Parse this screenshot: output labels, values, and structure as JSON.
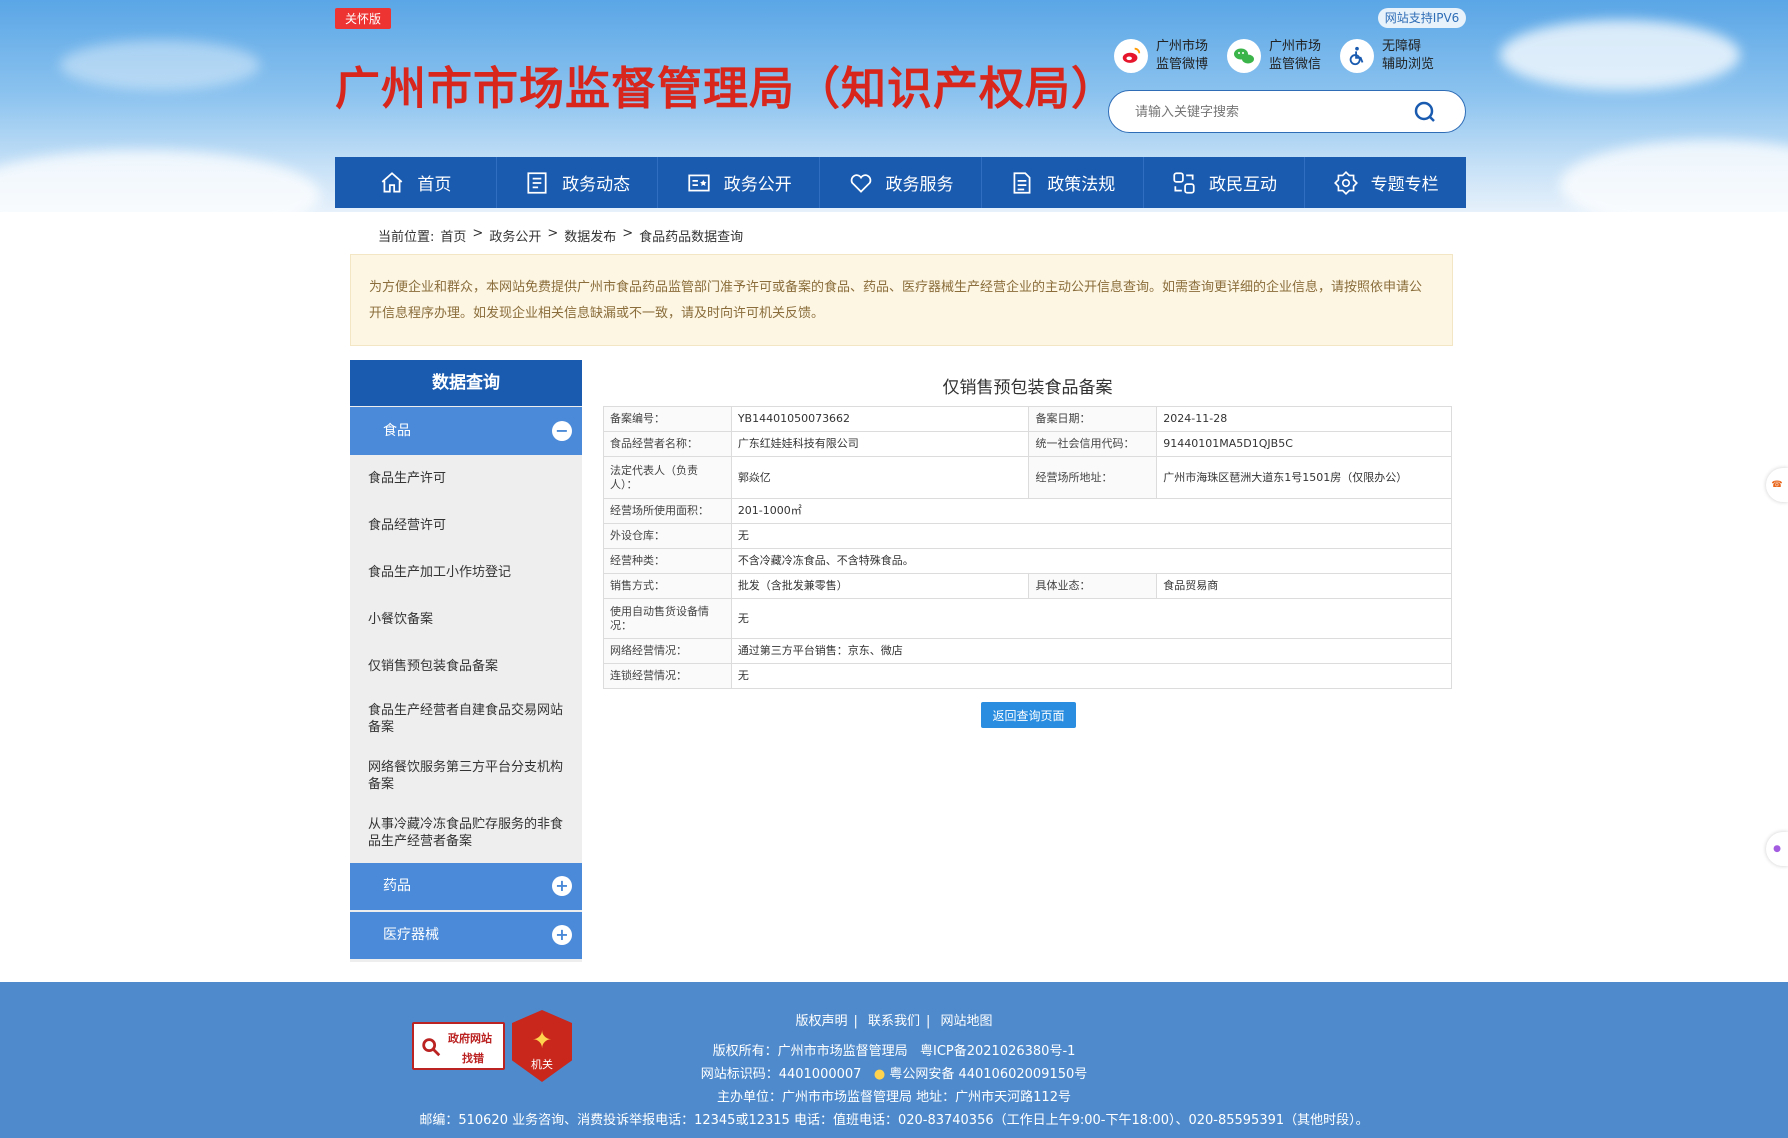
{
  "header": {
    "care_badge": "关怀版",
    "site_title": "广州市市场监督管理局（知识产权局）",
    "ipv6": "网站支持IPV6",
    "links": [
      {
        "line1": "广州市场",
        "line2": "监管微博",
        "icon": "weibo-icon"
      },
      {
        "line1": "广州市场",
        "line2": "监管微信",
        "icon": "wechat-icon"
      },
      {
        "line1": "无障碍",
        "line2": "辅助浏览",
        "icon": "accessibility-icon"
      }
    ],
    "search_placeholder": "请输入关键字搜索"
  },
  "nav": [
    "首页",
    "政务动态",
    "政务公开",
    "政务服务",
    "政策法规",
    "政民互动",
    "专题专栏"
  ],
  "breadcrumb": {
    "prefix": "当前位置:",
    "items": [
      "首页",
      "政务公开",
      "数据发布",
      "食品药品数据查询"
    ]
  },
  "notice": "为方便企业和群众，本网站免费提供广州市食品药品监管部门准予许可或备案的食品、药品、医疗器械生产经营企业的主动公开信息查询。如需查询更详细的企业信息，请按照依申请公开信息程序办理。如发现企业相关信息缺漏或不一致，请及时向许可机关反馈。",
  "sidebar": {
    "title": "数据查询",
    "categories": [
      {
        "label": "食品",
        "toggle": "−"
      },
      {
        "label": "药品",
        "toggle": "+"
      },
      {
        "label": "医疗器械",
        "toggle": "+"
      }
    ],
    "food_items": [
      "食品生产许可",
      "食品经营许可",
      "食品生产加工小作坊登记",
      "小餐饮备案",
      "仅销售预包装食品备案",
      "食品生产经营者自建食品交易网站备案",
      "网络餐饮服务第三方平台分支机构备案",
      "从事冷藏冷冻食品贮存服务的非食品生产经营者备案"
    ]
  },
  "main": {
    "title": "仅销售预包装食品备案",
    "rows": [
      {
        "l1": "备案编号：",
        "v1": "YB14401050073662",
        "l2": "备案日期：",
        "v2": "2024-11-28"
      },
      {
        "l1": "食品经营者名称：",
        "v1": "广东红娃娃科技有限公司",
        "l2": "统一社会信用代码：",
        "v2": "91440101MA5D1QJB5C"
      },
      {
        "l1": "法定代表人（负责人）：",
        "v1": "郭焱亿",
        "l2": "经营场所地址：",
        "v2": "广州市海珠区琶洲大道东1号1501房（仅限办公）"
      },
      {
        "l1": "经营场所使用面积：",
        "v1": "201-1000㎡"
      },
      {
        "l1": "外设仓库：",
        "v1": "无"
      },
      {
        "l1": "经营种类：",
        "v1": "不含冷藏冷冻食品、不含特殊食品。"
      },
      {
        "l1": "销售方式：",
        "v1": "批发（含批发兼零售）",
        "l2": "具体业态：",
        "v2": "食品贸易商"
      },
      {
        "l1": "使用自动售货设备情况：",
        "v1": "无"
      },
      {
        "l1": "网络经营情况：",
        "v1": "通过第三方平台销售：京东、微店"
      },
      {
        "l1": "连锁经营情况：",
        "v1": "无"
      }
    ],
    "back_button": "返回查询页面"
  },
  "footer": {
    "links": [
      "版权声明",
      "联系我们",
      "网站地图"
    ],
    "badge1_line1": "政府网站",
    "badge1_line2": "找错",
    "badge2_text": "机关",
    "copyright": "版权所有：广州市市场监督管理局",
    "icp": "粤ICP备2021026380号-1",
    "site_code": "网站标识码：4401000007",
    "police": "粤公网安备 44010602009150号",
    "sponsor": "主办单位：广州市市场监督管理局  地址：广州市天河路112号",
    "contact": "邮编：510620 业务咨询、消费投诉举报电话：12345或12315 电话：值班电话：020-83740356（工作日上午9:00-下午18:00）、020-85595391（其他时段）。"
  },
  "colors": {
    "brand_blue": "#1a5bb0",
    "category_blue": "#4a8ad8",
    "title_red": "#d8261c",
    "footer_blue": "#4f8bcc",
    "button_blue": "#2a8de0"
  }
}
